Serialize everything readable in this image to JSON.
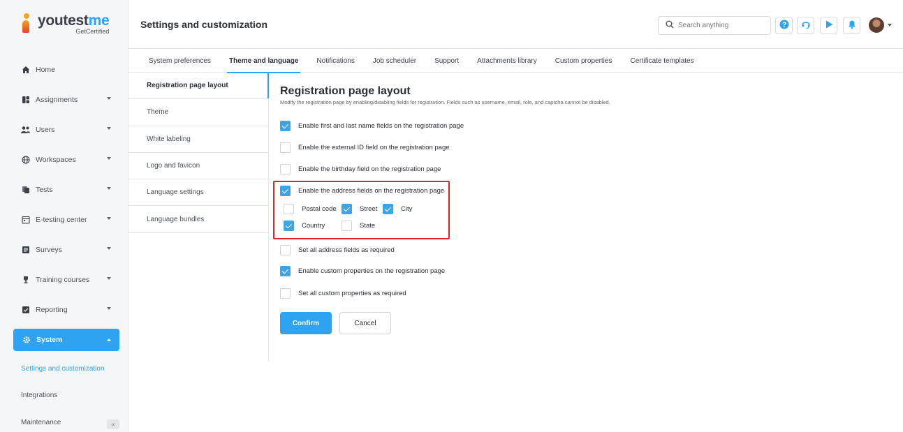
{
  "brand": {
    "name_part1": "youtest",
    "name_part2": "me",
    "tagline": "GetCertified"
  },
  "sidebar": {
    "items": [
      {
        "label": "Home",
        "icon": "home-icon"
      },
      {
        "label": "Assignments",
        "icon": "assignments-icon"
      },
      {
        "label": "Users",
        "icon": "users-icon"
      },
      {
        "label": "Workspaces",
        "icon": "globe-icon"
      },
      {
        "label": "Tests",
        "icon": "tests-icon"
      },
      {
        "label": "E-testing center",
        "icon": "calendar-icon"
      },
      {
        "label": "Surveys",
        "icon": "survey-icon"
      },
      {
        "label": "Training courses",
        "icon": "trophy-icon"
      },
      {
        "label": "Reporting",
        "icon": "reporting-icon"
      },
      {
        "label": "System",
        "icon": "gear-icon"
      }
    ],
    "sub_items": [
      {
        "label": "Settings and customization"
      },
      {
        "label": "Integrations"
      },
      {
        "label": "Maintenance"
      }
    ],
    "collapse_label": "«"
  },
  "header": {
    "title": "Settings and customization",
    "search_placeholder": "Search anything"
  },
  "tabs": [
    {
      "label": "System preferences"
    },
    {
      "label": "Theme and language"
    },
    {
      "label": "Notifications"
    },
    {
      "label": "Job scheduler"
    },
    {
      "label": "Support"
    },
    {
      "label": "Attachments library"
    },
    {
      "label": "Custom properties"
    },
    {
      "label": "Certificate templates"
    }
  ],
  "submenu": [
    {
      "label": "Registration page layout"
    },
    {
      "label": "Theme"
    },
    {
      "label": "White labeling"
    },
    {
      "label": "Logo and favicon"
    },
    {
      "label": "Language settings"
    },
    {
      "label": "Language bundles"
    }
  ],
  "main": {
    "title": "Registration page layout",
    "description": "Modify the registration page by enabling/disabling fields for registration. Fields such as username, email, role, and captcha cannot be disabled.",
    "options": [
      {
        "label": "Enable first and last name fields on the registration page",
        "checked": true
      },
      {
        "label": "Enable the external ID field on the registration page",
        "checked": false
      },
      {
        "label": "Enable the birthday field on the registration page",
        "checked": false
      },
      {
        "label": "Enable the address fields on the registration page",
        "checked": true
      },
      {
        "label": "Set all address fields as required",
        "checked": false
      },
      {
        "label": "Enable custom properties on the registration page",
        "checked": true
      },
      {
        "label": "Set all custom properties as required",
        "checked": false
      }
    ],
    "address_fields": [
      {
        "label": "Postal code",
        "checked": false
      },
      {
        "label": "Street",
        "checked": true
      },
      {
        "label": "City",
        "checked": true
      },
      {
        "label": "Country",
        "checked": true
      },
      {
        "label": "State",
        "checked": false
      }
    ],
    "confirm_label": "Confirm",
    "cancel_label": "Cancel"
  },
  "colors": {
    "accent": "#2ea3f2",
    "highlight_border": "#e0202a",
    "checkbox_on": "#3fa4e6"
  }
}
